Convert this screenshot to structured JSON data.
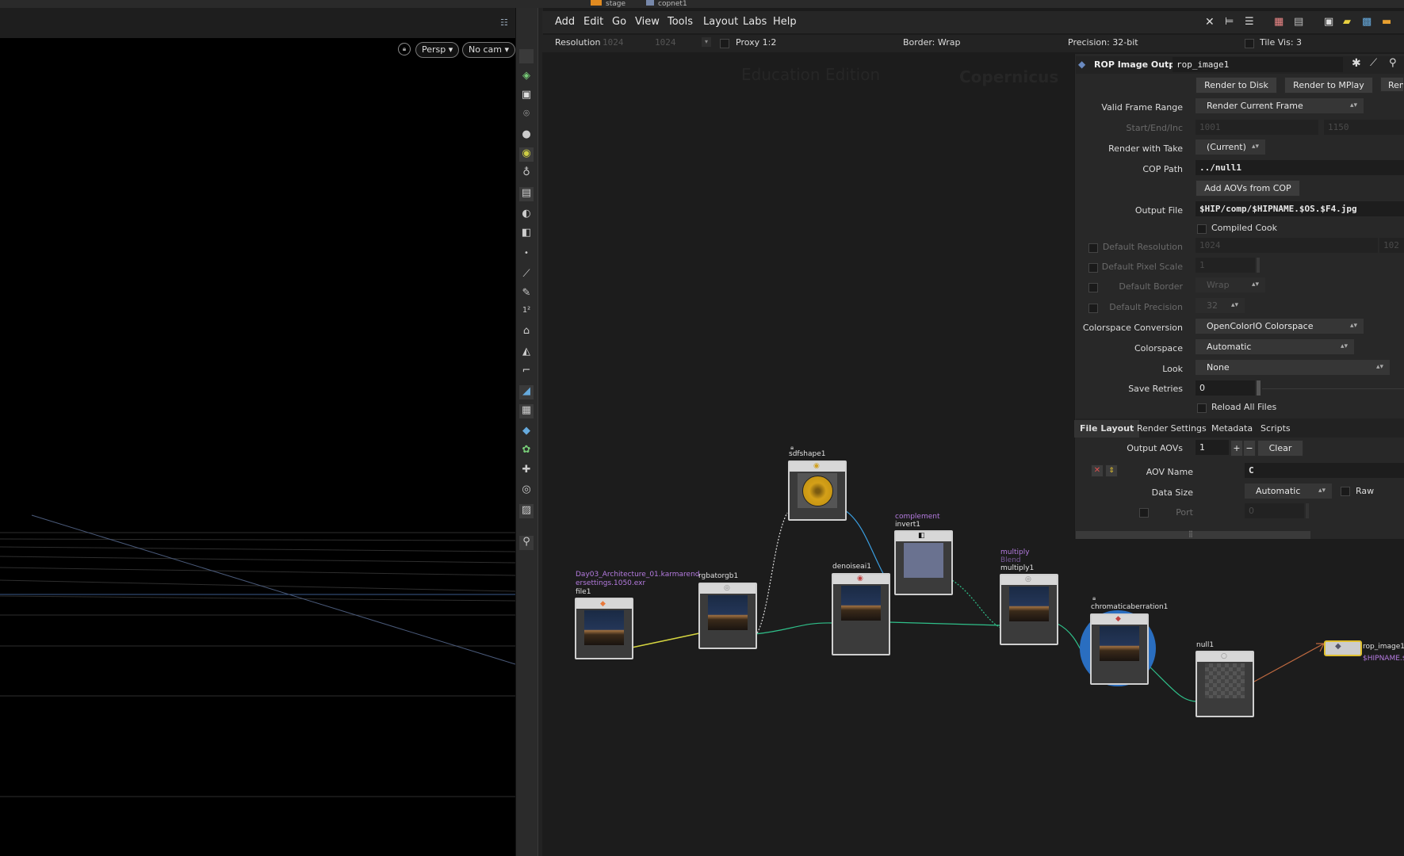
{
  "top_tabs": [
    "stage",
    "copnet1"
  ],
  "viewport": {
    "persp_label": "Persp ▾",
    "cam_label": "No cam ▾"
  },
  "menu": [
    "Add",
    "Edit",
    "Go",
    "View",
    "Tools",
    "Layout",
    "Labs",
    "Help"
  ],
  "netbar": {
    "resolution_label": "Resolution",
    "res_x": "1024",
    "res_y": "1024",
    "proxy": "Proxy 1:2",
    "border": "Border: Wrap",
    "precision": "Precision: 32-bit",
    "tilevis": "Tile Vis: 3"
  },
  "watermarks": {
    "edition": "Education Edition",
    "product": "Copernicus"
  },
  "nodes": {
    "file1": {
      "name": "file1",
      "comment_line1": "Day03_Architecture_01.karmarend",
      "comment_line2": "ersettings.1050.exr"
    },
    "rgbatorgb1": {
      "name": "rgbatorgb1"
    },
    "sdfshape1": {
      "name": "sdfshape1"
    },
    "denoiseai1": {
      "name": "denoiseai1"
    },
    "invert1": {
      "name": "invert1",
      "comment": "complement"
    },
    "multiply1": {
      "name": "multiply1",
      "comment": "multiply",
      "subcomment": "Blend"
    },
    "chromaticaberration1": {
      "name": "chromaticaberration1"
    },
    "null1": {
      "name": "null1"
    },
    "rop_image1": {
      "name": "rop_image1",
      "comment": "$HIPNAME.$OS"
    }
  },
  "params": {
    "node_type": "ROP Image Output",
    "node_name": "rop_image1",
    "render_to_disk": "Render to Disk",
    "render_to_mplay": "Render to MPlay",
    "render_cut": "Ren",
    "valid_frame_range_label": "Valid Frame Range",
    "valid_frame_range": "Render Current Frame",
    "start_end_inc_label": "Start/End/Inc",
    "start": "1001",
    "end": "1150",
    "render_with_take_label": "Render with Take",
    "render_with_take": "(Current)",
    "cop_path_label": "COP Path",
    "cop_path": "../null1",
    "add_aovs": "Add AOVs from COP",
    "output_file_label": "Output File",
    "output_file": "$HIP/comp/$HIPNAME.$OS.$F4.jpg",
    "compiled_cook": "Compiled Cook",
    "default_resolution_label": "Default Resolution",
    "default_resolution": "1024",
    "default_resolution_y": "102",
    "default_pixel_scale_label": "Default Pixel Scale",
    "default_pixel_scale": "1",
    "default_border_label": "Default Border",
    "default_border": "Wrap",
    "default_precision_label": "Default Precision",
    "default_precision": "32",
    "colorspace_conversion_label": "Colorspace Conversion",
    "colorspace_conversion": "OpenColorIO Colorspace",
    "colorspace_label": "Colorspace",
    "colorspace": "Automatic",
    "look_label": "Look",
    "look": "None",
    "save_retries_label": "Save Retries",
    "save_retries": "0",
    "reload_all_files": "Reload All Files",
    "tabs": [
      "File Layout",
      "Render Settings",
      "Metadata",
      "Scripts"
    ],
    "output_aovs_label": "Output AOVs",
    "output_aovs": "1",
    "clear": "Clear",
    "aov_name_label": "AOV Name",
    "aov_name": "C",
    "data_size_label": "Data Size",
    "data_size": "Automatic",
    "raw": "Raw",
    "port_label": "Port",
    "port": "0"
  },
  "colors": {
    "accent_yellow": "#e0c030",
    "wire_green": "#2fc08a",
    "wire_blue": "#3a9ee0",
    "comment_purple": "#b57be0"
  }
}
